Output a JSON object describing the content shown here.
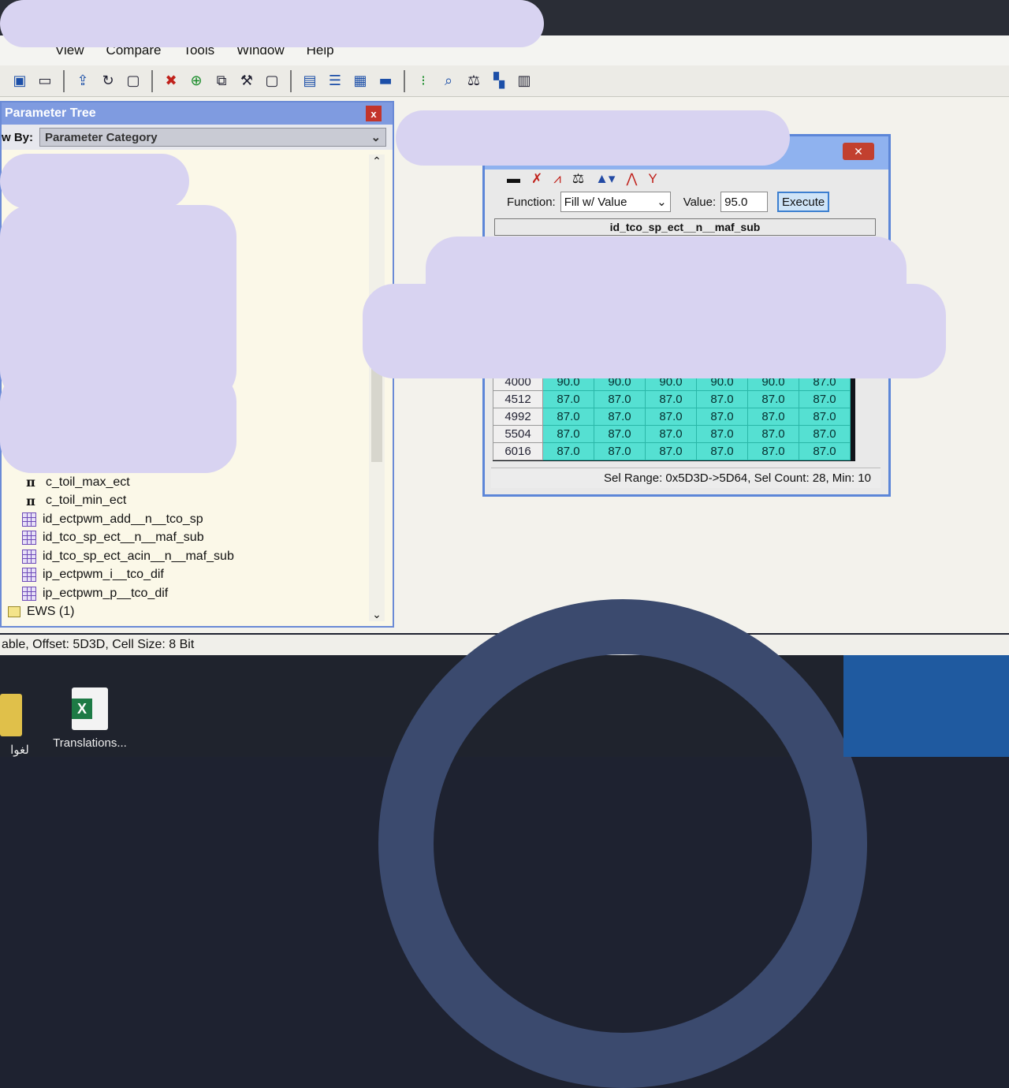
{
  "menu": [
    "View",
    "Compare",
    "Tools",
    "Window",
    "Help"
  ],
  "toolbar_icons": [
    "save-icon",
    "open-folder-icon",
    "export-icon",
    "refresh-icon",
    "new-document-icon",
    "delete-icon",
    "add-icon",
    "copy-icon",
    "wrench-icon",
    "blank-document-icon",
    "layout-icon",
    "split-icon",
    "window-icon",
    "monitor-icon",
    "binary-icon",
    "search-icon",
    "compare-scale-icon",
    "structure-icon",
    "grid-icon"
  ],
  "parameter_tree": {
    "title": "Parameter Tree",
    "view_by_label": "w By:",
    "view_by_value": "Parameter Category",
    "close_label": "x",
    "items": [
      {
        "icon": "pi",
        "label": "c_toil_max_ect"
      },
      {
        "icon": "pi",
        "label": "c_toil_min_ect"
      },
      {
        "icon": "grid",
        "label": "id_ectpwm_add__n__tco_sp"
      },
      {
        "icon": "grid",
        "label": "id_tco_sp_ect__n__maf_sub"
      },
      {
        "icon": "grid",
        "label": "id_tco_sp_ect_acin__n__maf_sub"
      },
      {
        "icon": "grid",
        "label": "ip_ectpwm_i__tco_dif"
      },
      {
        "icon": "grid",
        "label": "ip_ectpwm_p__tco_dif"
      },
      {
        "icon": "folder",
        "label": "EWS (1)"
      }
    ]
  },
  "dialog": {
    "close_label": "✕",
    "function_label": "Function:",
    "function_value": "Fill w/ Value",
    "value_label": "Value:",
    "value": "95.0",
    "execute_label": "Execute",
    "table_title": "id_tco_sp_ect__n__maf_sub",
    "rows": [
      {
        "header": "4000",
        "cells": [
          "90.0",
          "90.0",
          "90.0",
          "90.0",
          "90.0",
          "87.0"
        ]
      },
      {
        "header": "4512",
        "cells": [
          "87.0",
          "87.0",
          "87.0",
          "87.0",
          "87.0",
          "87.0"
        ]
      },
      {
        "header": "4992",
        "cells": [
          "87.0",
          "87.0",
          "87.0",
          "87.0",
          "87.0",
          "87.0"
        ]
      },
      {
        "header": "5504",
        "cells": [
          "87.0",
          "87.0",
          "87.0",
          "87.0",
          "87.0",
          "87.0"
        ]
      },
      {
        "header": "6016",
        "cells": [
          "87.0",
          "87.0",
          "87.0",
          "87.0",
          "87.0",
          "87.0"
        ]
      }
    ],
    "status": "Sel Range: 0x5D3D->5D64, Sel Count: 28, Min: 10"
  },
  "app_status": "able, Offset: 5D3D,  Cell Size: 8 Bit",
  "desktop": {
    "left_icon_label": "لغوا",
    "excel_icon_label": "Translations..."
  }
}
